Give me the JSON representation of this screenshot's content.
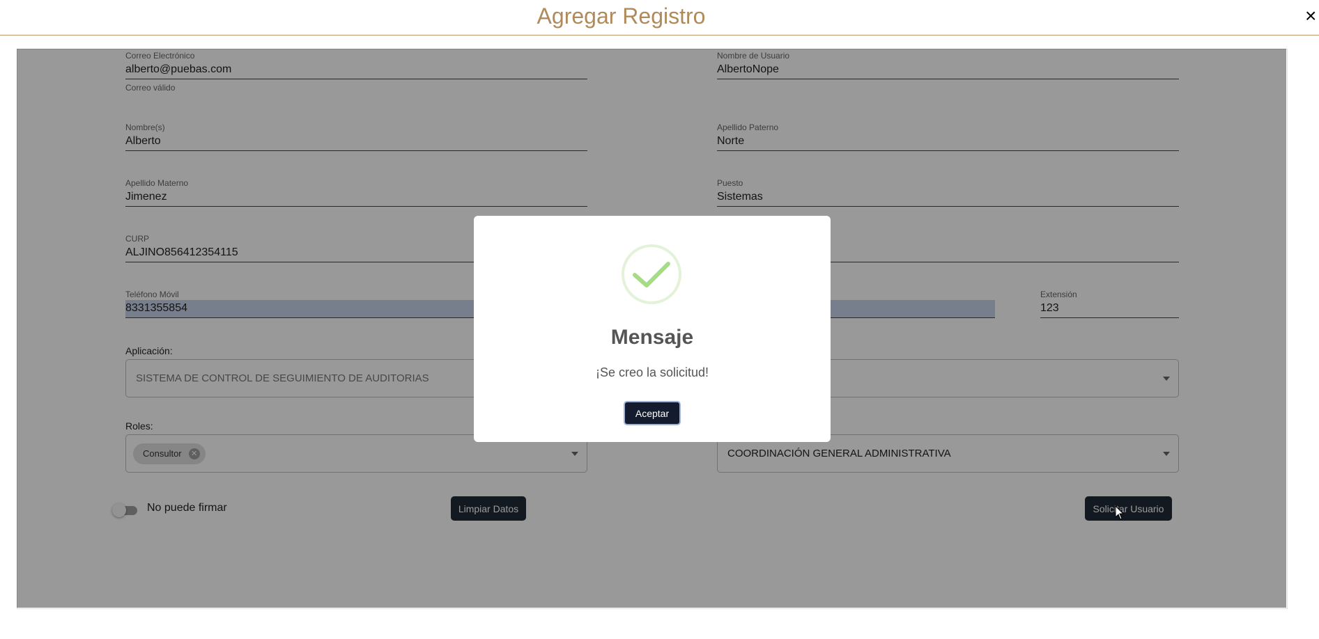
{
  "header": {
    "title": "Agregar Registro",
    "close_icon": "close-icon",
    "close_glyph": "×"
  },
  "form": {
    "email": {
      "label": "Correo Electrónico",
      "value": "alberto@puebas.com",
      "hint": "Correo válido"
    },
    "username": {
      "label": "Nombre de Usuario",
      "value": "AlbertoNope"
    },
    "nombre": {
      "label": "Nombre(s)",
      "value": "Alberto"
    },
    "apellido_paterno": {
      "label": "Apellido Paterno",
      "value": "Norte"
    },
    "apellido_materno": {
      "label": "Apellido Materno",
      "value": "Jimenez"
    },
    "puesto": {
      "label": "Puesto",
      "value": "Sistemas"
    },
    "curp": {
      "label": "CURP",
      "value": "ALJINO856412354115"
    },
    "telefono": {
      "label": "Teléfono Móvil",
      "value": "8331355854"
    },
    "extension": {
      "label": "Extensión",
      "value": "123"
    },
    "aplicacion": {
      "label": "Aplicación:",
      "value": "SISTEMA DE CONTROL DE SEGUIMIENTO DE AUDITORIAS"
    },
    "roles": {
      "label": "Roles:",
      "chip": "Consultor",
      "chip_remove_glyph": "✕"
    },
    "area": {
      "value": "COORDINACIÓN GENERAL ADMINISTRATIVA"
    },
    "firma_toggle": {
      "label": "No puede firmar",
      "checked": false
    },
    "clear_button": "Limpiar Datos",
    "submit_button": "Solicitar Usuario"
  },
  "dialog": {
    "icon": "check-circle-icon",
    "title": "Mensaje",
    "message": "¡Se creo la solicitud!",
    "ok_button": "Aceptar",
    "success_color": "#a5dc86"
  },
  "colors": {
    "header_title": "#b08a5a",
    "button_dark": "#1f2a38",
    "overlay": "rgba(0,0,0,0.4)"
  }
}
